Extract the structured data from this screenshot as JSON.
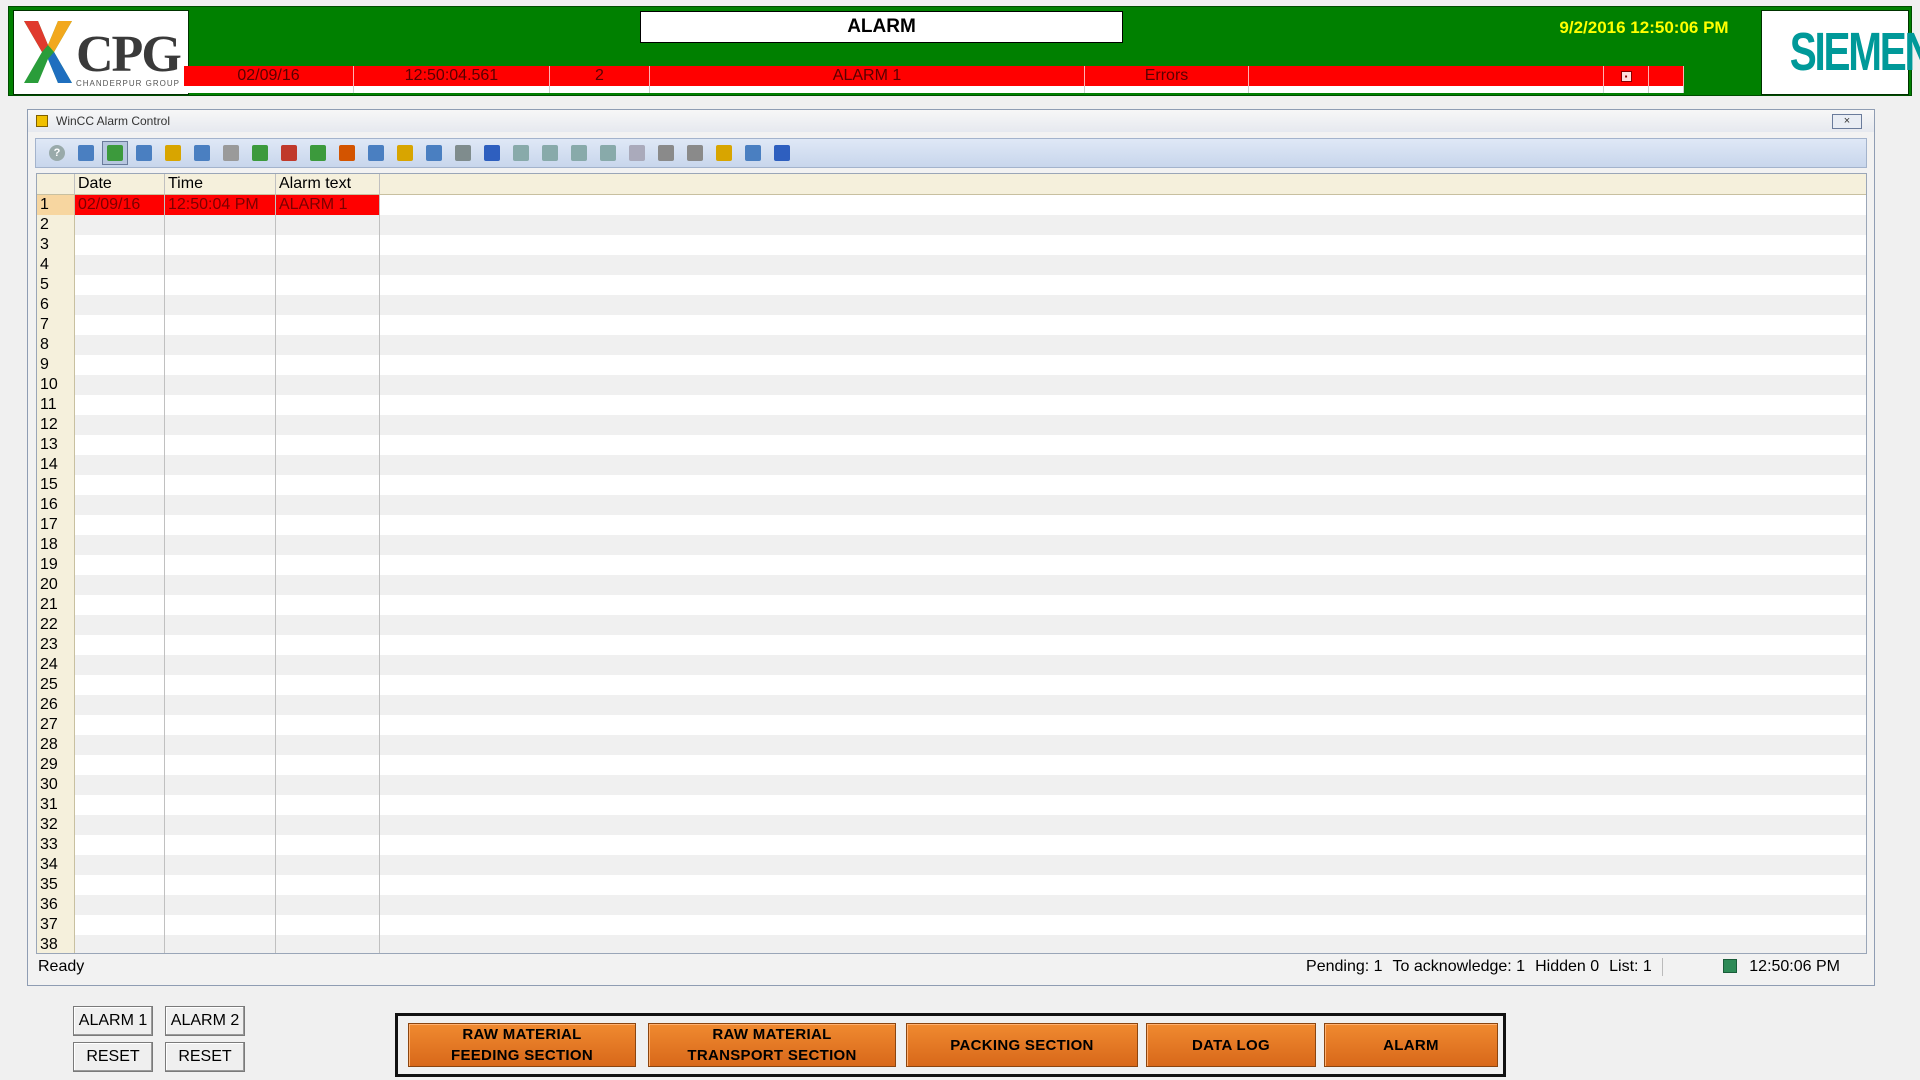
{
  "header": {
    "logo_left": {
      "main": "CPG",
      "sub": "CHANDERPUR GROUP"
    },
    "screen_title": "ALARM",
    "datetime": "9/2/2016 12:50:06 PM",
    "logo_right": "SIEMENS",
    "alarm_line": {
      "date": "02/09/16",
      "time": "12:50:04.561",
      "number": "2",
      "text": "ALARM 1",
      "class": "Errors",
      "color": "#ff0000"
    }
  },
  "alarm_control": {
    "title": "WinCC Alarm Control",
    "close_label": "×",
    "toolbar_icons": [
      "help-icon",
      "config-icon",
      "message-list-icon",
      "short-term-archive-icon",
      "long-term-archive-icon",
      "lock-list-icon",
      "hit-list-icon",
      "hidden-list-icon",
      "single-acknowledge-icon",
      "group-acknowledge-icon",
      "emergency-ack-icon",
      "selection-dialog-icon",
      "display-options-icon",
      "lock-dialog-icon",
      "print-icon",
      "autoscroll-icon",
      "first-message-icon",
      "previous-message-icon",
      "next-message-icon",
      "last-message-icon",
      "info-text-icon",
      "comment-icon",
      "loop-in-alarm-icon",
      "lock-icon",
      "sort-icon",
      "time-base-icon"
    ],
    "columns": [
      "",
      "Date",
      "Time",
      "Alarm text",
      ""
    ],
    "rows": [
      {
        "num": "1",
        "date": "02/09/16",
        "time": "12:50:04 PM",
        "text": "ALARM 1"
      }
    ],
    "total_rows": 38,
    "status": {
      "ready": "Ready",
      "pending": "Pending: 1",
      "to_ack": "To acknowledge: 1",
      "hidden": "Hidden 0",
      "list": "List: 1",
      "time": "12:50:06 PM"
    }
  },
  "controls": {
    "alarm1": "ALARM 1",
    "alarm2": "ALARM 2",
    "reset1": "RESET",
    "reset2": "RESET"
  },
  "nav": {
    "raw_feed_1": "RAW MATERIAL",
    "raw_feed_2": "FEEDING SECTION",
    "raw_trans_1": "RAW MATERIAL",
    "raw_trans_2": "TRANSPORT SECTION",
    "packing": "PACKING SECTION",
    "datalog": "DATA LOG",
    "alarm": "ALARM"
  },
  "colors": {
    "header_bg": "#008000",
    "clock": "#ffff00",
    "alarm_red": "#ff0000",
    "nav_orange": "#e8771e",
    "siemens": "#009999"
  }
}
